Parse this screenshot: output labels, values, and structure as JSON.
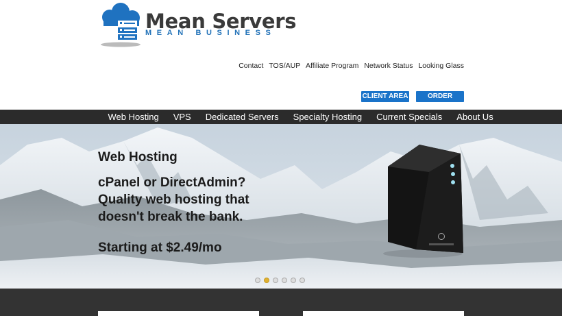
{
  "logo": {
    "title": "Mean Servers",
    "subtitle": "MEAN BUSINESS",
    "brand_color": "#2272b8"
  },
  "top_links": [
    "Contact",
    "TOS/AUP",
    "Affiliate Program",
    "Network Status",
    "Looking Glass"
  ],
  "buttons": {
    "client_area": "CLIENT AREA",
    "order": "ORDER",
    "color": "#1a73c9"
  },
  "nav": {
    "items": [
      "Web Hosting",
      "VPS",
      "Dedicated Servers",
      "Specialty Hosting",
      "Current Specials",
      "About Us"
    ]
  },
  "hero": {
    "title": "Web Hosting",
    "lines": [
      "cPanel or DirectAdmin?",
      "Quality web hosting that",
      "doesn't break the bank."
    ],
    "price": "Starting at $2.49/mo",
    "slides": 6,
    "active_slide": 2
  }
}
